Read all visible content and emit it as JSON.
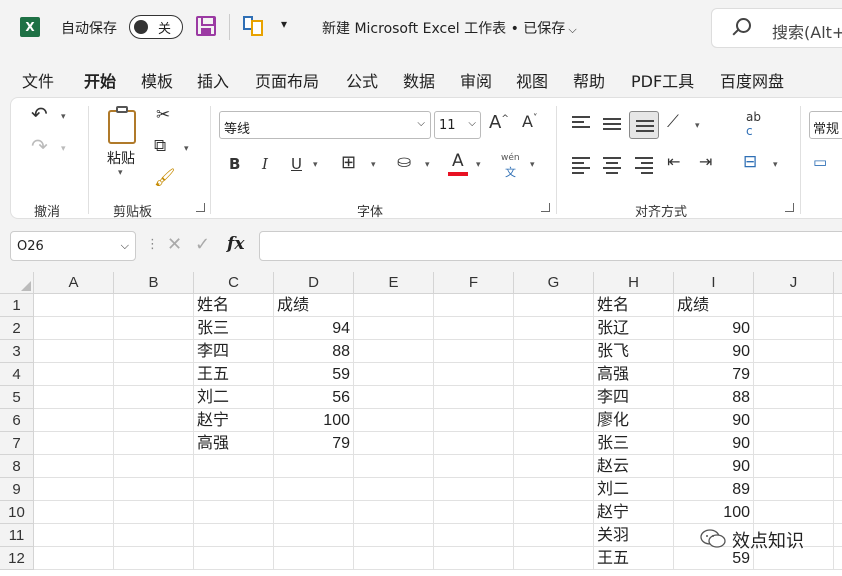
{
  "titlebar": {
    "autosave_label": "自动保存",
    "autosave_state": "关",
    "doc_title": "新建 Microsoft Excel 工作表 • 已保存",
    "search_text": "搜索(Alt+"
  },
  "menu": {
    "tabs": [
      "文件",
      "开始",
      "模板",
      "插入",
      "页面布局",
      "公式",
      "数据",
      "审阅",
      "视图",
      "帮助",
      "PDF工具",
      "百度网盘"
    ],
    "active": "开始"
  },
  "ribbon": {
    "groups": {
      "undo": "撤消",
      "clipboard": "剪贴板",
      "font": "字体",
      "alignment": "对齐方式"
    },
    "paste_label": "粘贴",
    "font_name": "等线",
    "font_size": "11",
    "bold": "B",
    "italic": "I",
    "underline": "U",
    "font_color_glyph": "A",
    "grow_font": "A^",
    "shrink_font": "A˅",
    "phonetic_top": "wén",
    "phonetic_bottom": "文",
    "wrap_top": "ab",
    "wrap_bottom": "c",
    "number_format": "常规",
    "accent_color": "#1e7145",
    "font_color": "#e81123"
  },
  "formula_bar": {
    "name_box": "O26",
    "fx": "fx",
    "formula": ""
  },
  "sheet": {
    "columns": [
      "A",
      "B",
      "C",
      "D",
      "E",
      "F",
      "G",
      "H",
      "I",
      "J"
    ],
    "rows": [
      "1",
      "2",
      "3",
      "4",
      "5",
      "6",
      "7",
      "8",
      "9",
      "10",
      "11",
      "12"
    ],
    "table1": {
      "headers": [
        "姓名",
        "成绩"
      ],
      "rows": [
        [
          "张三",
          "94"
        ],
        [
          "李四",
          "88"
        ],
        [
          "王五",
          "59"
        ],
        [
          "刘二",
          "56"
        ],
        [
          "赵宁",
          "100"
        ],
        [
          "高强",
          "79"
        ]
      ]
    },
    "table2": {
      "headers": [
        "姓名",
        "成绩"
      ],
      "rows": [
        [
          "张辽",
          "90"
        ],
        [
          "张飞",
          "90"
        ],
        [
          "高强",
          "79"
        ],
        [
          "李四",
          "88"
        ],
        [
          "廖化",
          "90"
        ],
        [
          "张三",
          "90"
        ],
        [
          "赵云",
          "90"
        ],
        [
          "刘二",
          "89"
        ],
        [
          "赵宁",
          "100"
        ],
        [
          "关羽",
          ""
        ],
        [
          "王五",
          "59"
        ]
      ]
    }
  },
  "watermark": {
    "text": "效点知识"
  }
}
